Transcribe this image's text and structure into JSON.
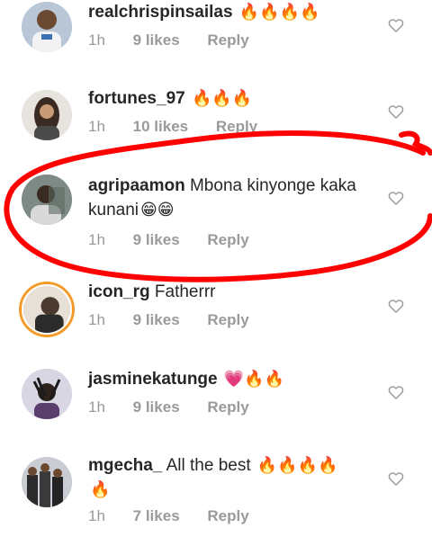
{
  "comments": [
    {
      "username": "realchrispinsailas",
      "text": "",
      "emoji": "🔥🔥🔥🔥",
      "time": "1h",
      "likes": "9 likes",
      "reply": "Reply",
      "avatar": "avatar-person-white-shirt"
    },
    {
      "username": "fortunes_97",
      "text": "",
      "emoji": "🔥🔥🔥",
      "time": "1h",
      "likes": "10 likes",
      "reply": "Reply",
      "avatar": "avatar-person-long-hair"
    },
    {
      "username": "agripaamon",
      "text": "Mbona kinyonge kaka kunani",
      "emoji": "😁😁",
      "time": "1h",
      "likes": "9 likes",
      "reply": "Reply",
      "avatar": "avatar-person-dark"
    },
    {
      "username": "icon_rg",
      "text": "Fatherrr",
      "emoji": "",
      "time": "1h",
      "likes": "9 likes",
      "reply": "Reply",
      "avatar": "avatar-story-ring"
    },
    {
      "username": "jasminekatunge",
      "text": "",
      "emoji": "💗🔥🔥",
      "time": "1h",
      "likes": "9 likes",
      "reply": "Reply",
      "avatar": "avatar-person-dreadlocks"
    },
    {
      "username": "mgecha_",
      "text": "All the best",
      "emoji": "🔥🔥🔥🔥",
      "emoji2": "🔥",
      "time": "1h",
      "likes": "7 likes",
      "reply": "Reply",
      "avatar": "avatar-group-photo"
    }
  ],
  "colors": {
    "annotation": "#ff0000",
    "meta": "#9a9a9a",
    "ring": "#f39a2a"
  },
  "icons": {
    "like": "heart-outline-icon"
  }
}
